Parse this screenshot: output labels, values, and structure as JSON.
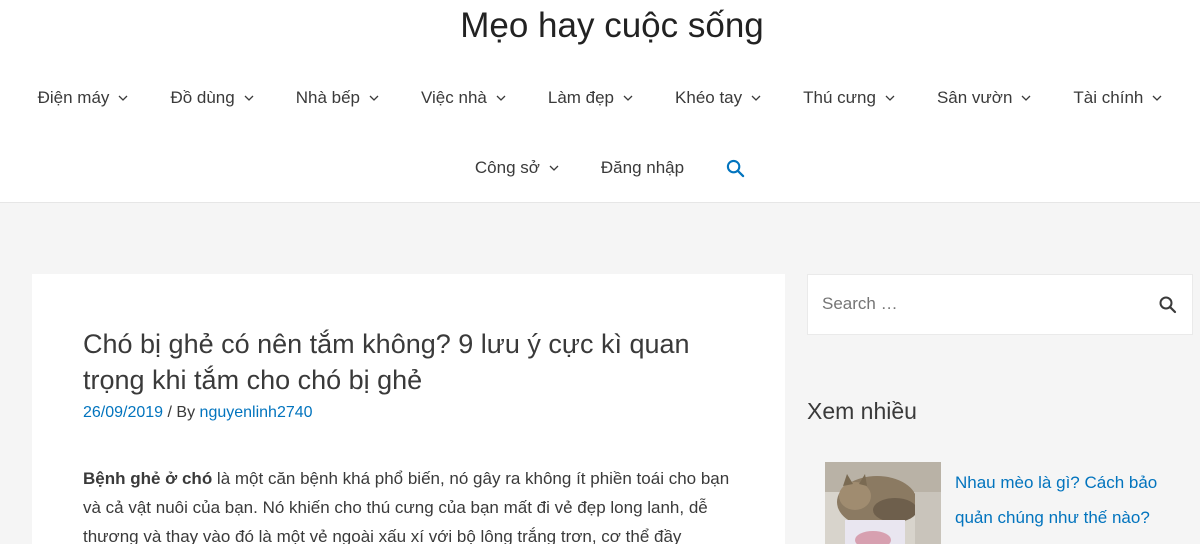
{
  "site": {
    "title": "Mẹo hay cuộc sống"
  },
  "nav": {
    "row1": [
      {
        "label": "Điện máy"
      },
      {
        "label": "Đồ dùng"
      },
      {
        "label": "Nhà bếp"
      },
      {
        "label": "Việc nhà"
      },
      {
        "label": "Làm đẹp"
      },
      {
        "label": "Khéo tay"
      },
      {
        "label": "Thú cưng"
      },
      {
        "label": "Sân vườn"
      },
      {
        "label": "Tài chính"
      }
    ],
    "row2": [
      {
        "label": "Công sở"
      },
      {
        "label": "Đăng nhập"
      }
    ]
  },
  "post": {
    "title": "Chó bị ghẻ có nên tắm không? 9 lưu ý cực kì quan trọng khi tắm cho chó bị ghẻ",
    "date": "26/09/2019",
    "by": "/ By",
    "author": "nguyenlinh2740",
    "intro_bold": "Bệnh ghẻ ở chó",
    "intro_text": " là một căn bệnh khá phổ biến, nó gây ra không ít phiền toái cho bạn và cả vật nuôi của bạn. Nó khiến cho thú cưng của bạn mất đi vẻ đẹp long lanh, dễ thương và thay vào đó là một vẻ ngoài xấu xí với bộ lông trắng trơn, cơ thể đầy"
  },
  "sidebar": {
    "search_placeholder": "Search …",
    "widget_title": "Xem nhiều",
    "popular": [
      {
        "title": "Nhau mèo là gì? Cách bảo quản chúng như thế nào?"
      }
    ]
  },
  "colors": {
    "accent": "#0274be",
    "text": "#3a3a3a",
    "background": "#f5f5f5"
  },
  "icons": {
    "search": "search-icon",
    "dropdown": "chevron-down-icon"
  }
}
